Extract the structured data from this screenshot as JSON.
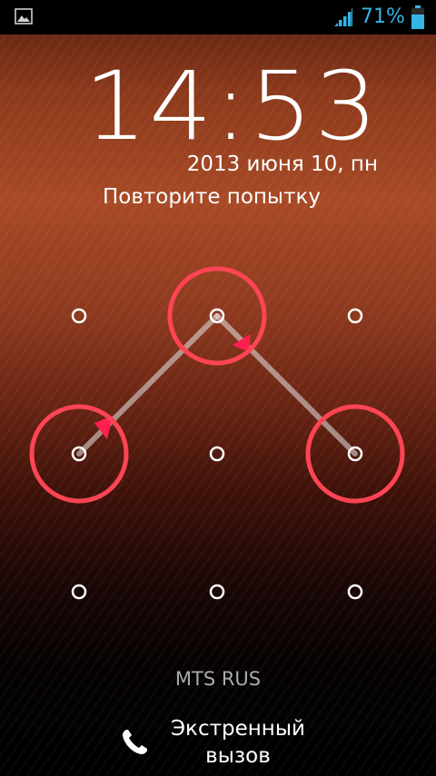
{
  "status_bar": {
    "battery_percent": "71%",
    "accent_color": "#33b5e5",
    "icons": [
      "gallery-icon",
      "signal-icon",
      "battery-icon"
    ]
  },
  "lock_screen": {
    "time": "14:53",
    "date": "2013 июня 10, пн",
    "status_message": "Повторите попытку",
    "carrier": "MTS RUS",
    "emergency_label": "Экстренный\nвызов"
  },
  "pattern": {
    "grid": "3x3",
    "selected_dots": [
      3,
      1,
      5
    ],
    "error_color": "#ff4454"
  }
}
